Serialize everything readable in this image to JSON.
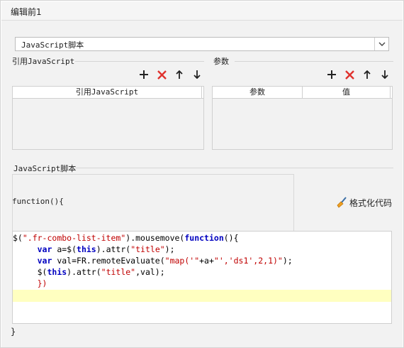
{
  "window": {
    "title": "编辑前1"
  },
  "script_type_select": {
    "value": "JavaScript脚本"
  },
  "ref_js_section": {
    "label": "引用JavaScript",
    "column_header": "引用JavaScript",
    "rows": []
  },
  "params_section": {
    "label": "参数",
    "columns": [
      "参数",
      "值"
    ],
    "rows": []
  },
  "toolbar": {
    "add_icon": "plus-icon",
    "delete_icon": "red-x-icon",
    "up_icon": "arrow-up-icon",
    "down_icon": "arrow-down-icon",
    "delete_color": "#e0322d"
  },
  "script_section": {
    "label": "JavaScript脚本",
    "function_header": "function(){",
    "format_button": "格式化代码",
    "closing": "}"
  },
  "code": {
    "lines": [
      "$(\".fr-combo-list-item\").mousemove(function(){",
      "     var a=$(this).attr(\"title\");",
      "     var val=FR.remoteEvaluate(\"map('\"+a+\"','ds1',2,1)\");",
      "     $(this).attr(\"title\",val);",
      "     })",
      ""
    ],
    "highlight_color": "#ffffc0",
    "keyword_color": "#0000c0",
    "string_color": "#c00000"
  }
}
